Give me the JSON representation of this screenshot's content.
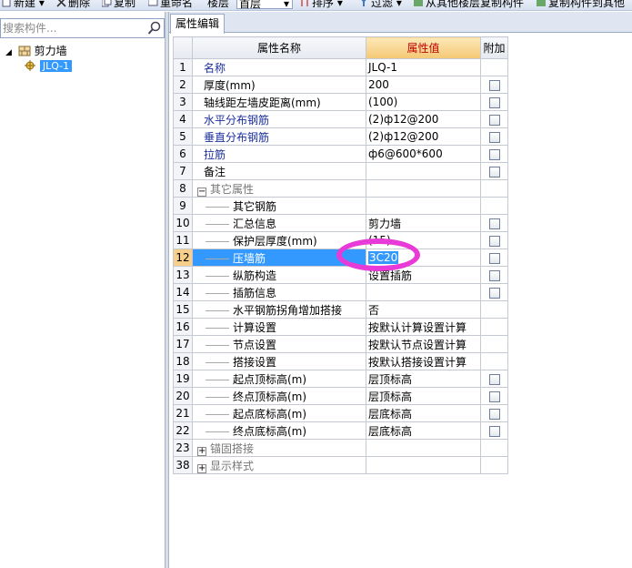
{
  "toolbar": {
    "items": [
      "新建",
      "删除",
      "复制",
      "重命名",
      "楼层",
      "首层",
      "排序",
      "过滤",
      "从其他楼层复制构件",
      "复制构件到其他"
    ]
  },
  "search": {
    "placeholder": "搜索构件..."
  },
  "tree": {
    "root": {
      "label": "剪力墙",
      "expander": "−"
    },
    "child": {
      "label": "JLQ-1"
    }
  },
  "tab": {
    "label": "属性编辑"
  },
  "grid": {
    "headers": {
      "name": "属性名称",
      "value": "属性值",
      "add": "附加"
    },
    "rows": [
      {
        "num": "1",
        "name": "名称",
        "value": "JLQ-1",
        "style": "blue",
        "check": false
      },
      {
        "num": "2",
        "name": "厚度(mm)",
        "value": "200",
        "style": "",
        "check": true
      },
      {
        "num": "3",
        "name": "轴线距左墙皮距离(mm)",
        "value": "(100)",
        "style": "",
        "check": true
      },
      {
        "num": "4",
        "name": "水平分布钢筋",
        "value": "(2)ф12@200",
        "style": "blue",
        "check": true
      },
      {
        "num": "5",
        "name": "垂直分布钢筋",
        "value": "(2)ф12@200",
        "style": "blue",
        "check": true
      },
      {
        "num": "6",
        "name": "拉筋",
        "value": "ф6@600*600",
        "style": "blue",
        "check": true
      },
      {
        "num": "7",
        "name": "备注",
        "value": "",
        "style": "",
        "check": true
      },
      {
        "num": "8",
        "name": "其它属性",
        "value": "",
        "style": "group",
        "expander": "−",
        "check": false
      },
      {
        "num": "9",
        "name": "其它钢筋",
        "value": "",
        "style": "child",
        "check": false
      },
      {
        "num": "10",
        "name": "汇总信息",
        "value": "剪力墙",
        "style": "child",
        "check": true
      },
      {
        "num": "11",
        "name": "保护层厚度(mm)",
        "value": "(15)",
        "style": "child",
        "check": true
      },
      {
        "num": "12",
        "name": "压墙筋",
        "value": "3C20",
        "style": "child-selected",
        "check": true
      },
      {
        "num": "13",
        "name": "纵筋构造",
        "value": "设置插筋",
        "style": "child",
        "check": true
      },
      {
        "num": "14",
        "name": "插筋信息",
        "value": "",
        "style": "child",
        "check": true
      },
      {
        "num": "15",
        "name": "水平钢筋拐角增加搭接",
        "value": "否",
        "style": "child",
        "check": false
      },
      {
        "num": "16",
        "name": "计算设置",
        "value": "按默认计算设置计算",
        "style": "child",
        "check": false
      },
      {
        "num": "17",
        "name": "节点设置",
        "value": "按默认节点设置计算",
        "style": "child",
        "check": false
      },
      {
        "num": "18",
        "name": "搭接设置",
        "value": "按默认搭接设置计算",
        "style": "child",
        "check": false
      },
      {
        "num": "19",
        "name": "起点顶标高(m)",
        "value": "层顶标高",
        "style": "child",
        "check": true
      },
      {
        "num": "20",
        "name": "终点顶标高(m)",
        "value": "层顶标高",
        "style": "child",
        "check": true
      },
      {
        "num": "21",
        "name": "起点底标高(m)",
        "value": "层底标高",
        "style": "child",
        "check": true
      },
      {
        "num": "22",
        "name": "终点底标高(m)",
        "value": "层底标高",
        "style": "child",
        "check": true
      },
      {
        "num": "23",
        "name": "锚固搭接",
        "value": "",
        "style": "group",
        "expander": "+",
        "check": false
      },
      {
        "num": "38",
        "name": "显示样式",
        "value": "",
        "style": "group",
        "expander": "+",
        "check": false
      }
    ]
  },
  "colors": {
    "selection": "#3399ff",
    "highlight_ellipse": "#e83ad6",
    "value_header": "#c00000",
    "blue_label": "#1b2f9c"
  }
}
